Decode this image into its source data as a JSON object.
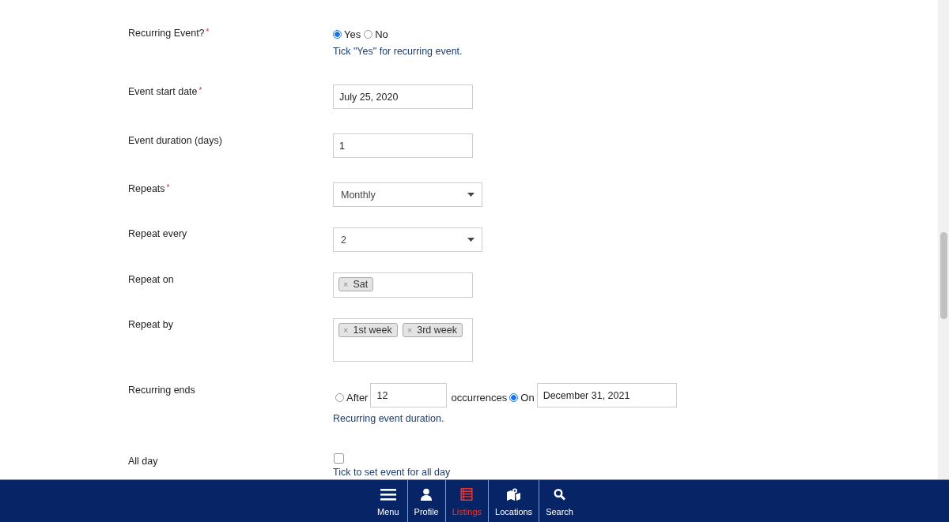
{
  "form": {
    "rows": [
      {
        "kind": "radio",
        "label": "Recurring Event?",
        "required_mark": "*",
        "options": [
          {
            "label": "Yes",
            "selected": true
          },
          {
            "label": "No",
            "selected": false
          }
        ],
        "help": "Tick \"Yes\" for recurring event."
      },
      {
        "kind": "text",
        "label": "Event start date",
        "required_mark": "*",
        "value": "July 25, 2020"
      },
      {
        "kind": "text",
        "label": "Event duration (days)",
        "value": "1"
      },
      {
        "kind": "select",
        "label": "Repeats",
        "required_mark": "*",
        "value": "Monthly"
      },
      {
        "kind": "select",
        "label": "Repeat every",
        "value": "2"
      },
      {
        "kind": "tags",
        "label": "Repeat on",
        "tags": [
          {
            "remove": "×",
            "label": "Sat"
          }
        ]
      },
      {
        "kind": "tags",
        "label": "Repeat by",
        "tags": [
          {
            "remove": "×",
            "label": "1st week"
          },
          {
            "remove": "×",
            "label": "3rd week"
          }
        ]
      },
      {
        "kind": "ends",
        "label": "Recurring ends",
        "after": {
          "label": "After",
          "selected": false,
          "value": "12",
          "suffix": "occurrences"
        },
        "on": {
          "label": "On",
          "selected": true,
          "value": "December 31, 2021"
        },
        "help": "Recurring event duration."
      },
      {
        "kind": "checkbox",
        "label": "All day",
        "checked": false,
        "help": "Tick to set event for all day"
      }
    ]
  },
  "nav": [
    {
      "label": "Menu",
      "selected": false
    },
    {
      "label": "Profile",
      "selected": false
    },
    {
      "label": "Listings",
      "selected": true
    },
    {
      "label": "Locations",
      "selected": false
    },
    {
      "label": "Search",
      "selected": false
    }
  ]
}
